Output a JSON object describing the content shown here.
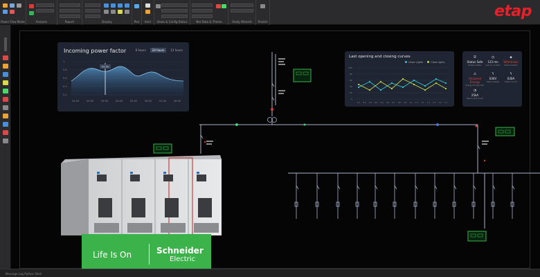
{
  "ribbon": {
    "groups": [
      "Power Flow Mode",
      "Analysis",
      "Report",
      "Display",
      "Plot",
      "Alert",
      "Views & Config Status",
      "Net Data & Theme",
      "Study Wizards",
      "Predict"
    ],
    "brand": "etap"
  },
  "status": {
    "text": "Message Log  Python Shell"
  },
  "power_factor": {
    "title": "Incoming power factor",
    "tabs": [
      "6 hours",
      "24 hours",
      "12 hours"
    ],
    "active_tab": "24 hours",
    "yticks": [
      "1",
      "0.8",
      "0.6",
      "0.4",
      "0.2"
    ],
    "xticks": [
      "01:00",
      "02:00",
      "03:00",
      "04:00",
      "05:00",
      "06:00",
      "07:00",
      "08:00"
    ],
    "tooltip": "03:00"
  },
  "curves": {
    "title": "Last opening and closing curves",
    "legend": [
      "Close Lights",
      "Close lights"
    ],
    "yticks": [
      "100",
      "80",
      "60",
      "40",
      "20",
      "0"
    ],
    "xticks": [
      "0.1",
      "0.2",
      "0.3",
      "0.4",
      "0.5",
      "0.6",
      "0.7",
      "0.8",
      "0.9",
      "1.1",
      "1.2",
      "1.3",
      "1.4",
      "1.5",
      "1.6",
      "1.7"
    ]
  },
  "info": [
    {
      "icon": "shield",
      "value": "Status Safe",
      "label": "Breaker Status",
      "warn": false
    },
    {
      "icon": "timer",
      "value": "123 mn",
      "label": "Last op. on time",
      "warn": false
    },
    {
      "icon": "drop",
      "value": "Withdrawn",
      "label": "Switch position",
      "warn": true
    },
    {
      "icon": "warning",
      "value": "Unstored Energy",
      "label": "Energy Storage Hist.",
      "warn": true
    },
    {
      "icon": "bolt",
      "value": "630V",
      "label": "Rated voltage",
      "warn": false
    },
    {
      "icon": "bolt",
      "value": "630A",
      "label": "Rated current",
      "warn": false
    },
    {
      "icon": "gauge",
      "value": "25kA",
      "label": "Rated short circuit",
      "warn": false
    }
  ],
  "banner": {
    "life": "Life Is On",
    "schneider": "Schneider",
    "electric": "Electric"
  },
  "colors": {
    "accent": "#e8202a",
    "sld_line": "#a9b4cc",
    "green": "#3cb34a",
    "series1": "#35c5d8",
    "series2": "#c8d84a"
  }
}
